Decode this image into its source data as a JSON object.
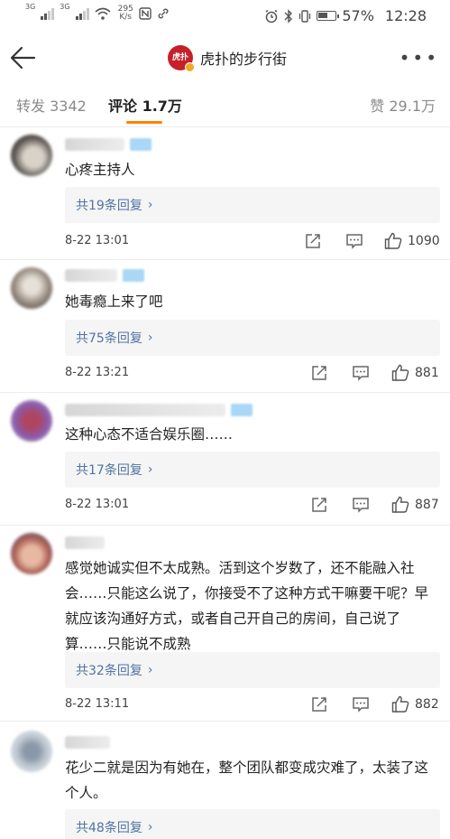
{
  "status_bar": {
    "net1": "3G",
    "net2": "3G",
    "speed_value": "295",
    "speed_unit": "K/s",
    "battery": "57%",
    "time": "12:28"
  },
  "header": {
    "title": "虎扑的步行街",
    "logo_text": "虎扑"
  },
  "tabs": {
    "repost": "转发 3342",
    "comments": "评论 1.7万",
    "likes": "赞 29.1万"
  },
  "comments": [
    {
      "text": "心疼主持人",
      "replies": "共19条回复",
      "time": "8-22 13:01",
      "likes": "1090"
    },
    {
      "text": "她毒瘾上来了吧",
      "replies": "共75条回复",
      "time": "8-22 13:21",
      "likes": "881"
    },
    {
      "text": "这种心态不适合娱乐圈……",
      "replies": "共17条回复",
      "time": "8-22 13:01",
      "likes": "887"
    },
    {
      "text": "感觉她诚实但不太成熟。活到这个岁数了，还不能融入社会……只能这么说了，你接受不了这种方式干嘛要干呢？早就应该沟通好方式，或者自己开自己的房间，自己说了算……只能说不成熟",
      "replies": "共32条回复",
      "time": "8-22 13:11",
      "likes": "882"
    },
    {
      "text": "花少二就是因为有她在，整个团队都变成灾难了，太装了这个人。",
      "replies": "共48条回复",
      "time": "",
      "likes": ""
    }
  ],
  "colors": {
    "accent": "#ff8200",
    "link": "#5074a2",
    "logo": "#c8202a"
  }
}
